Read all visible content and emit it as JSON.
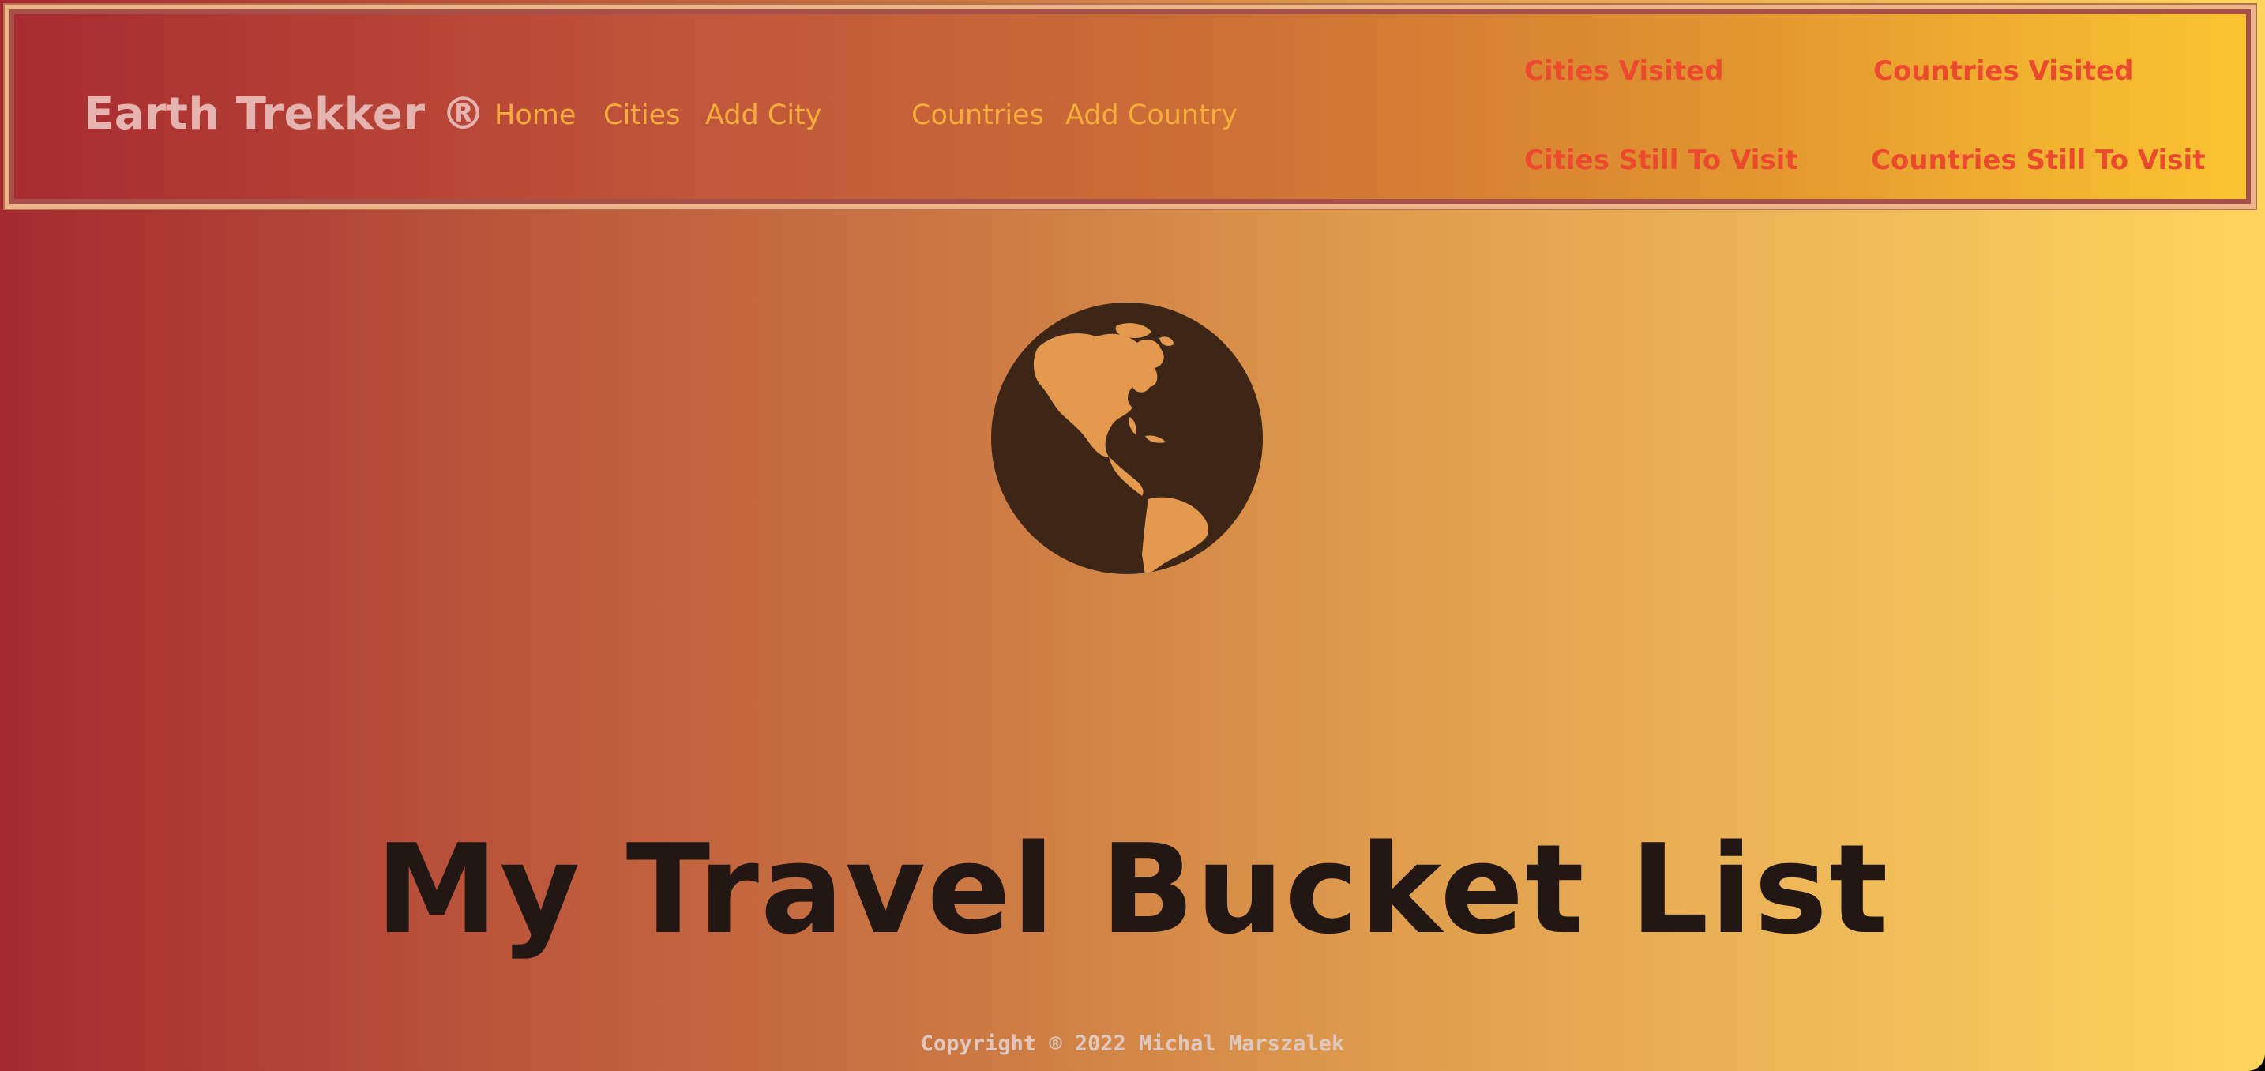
{
  "brand": {
    "name": "Earth Trekker ®"
  },
  "nav": {
    "links": [
      {
        "label": "Home"
      },
      {
        "label": "Cities"
      },
      {
        "label": "Add City"
      },
      {
        "label": "Countries"
      },
      {
        "label": "Add Country"
      }
    ]
  },
  "stats": {
    "cities_visited": "Cities Visited",
    "countries_visited": "Countries Visited",
    "cities_to_visit": "Cities Still To Visit",
    "countries_to_visit": "Countries Still To Visit"
  },
  "hero": {
    "icon": "globe-americas-icon",
    "title": "My Travel Bucket List"
  },
  "footer": {
    "copyright": "Copyright ® 2022 Michal Marszalek"
  },
  "colors": {
    "nav_link": "#f7ad3b",
    "stat_link": "#ec4a2f",
    "brand": "#e5b4b0",
    "globe": "#3e2616",
    "title": "#231714"
  }
}
